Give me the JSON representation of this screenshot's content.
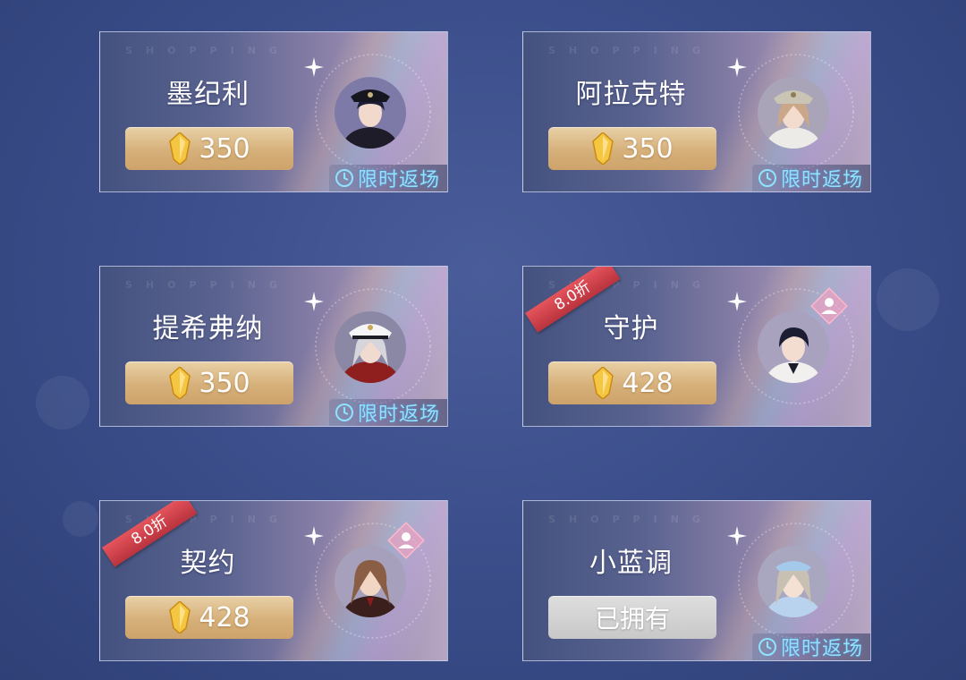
{
  "watermark": "SHOPPING",
  "cards": [
    {
      "name": "墨纪利",
      "price": "350",
      "owned": false,
      "tag": "限时返场",
      "discount": "",
      "has_badge": false
    },
    {
      "name": "阿拉克特",
      "price": "350",
      "owned": false,
      "tag": "限时返场",
      "discount": "",
      "has_badge": false
    },
    {
      "name": "提希弗纳",
      "price": "350",
      "owned": false,
      "tag": "限时返场",
      "discount": "",
      "has_badge": false
    },
    {
      "name": "守护",
      "price": "428",
      "owned": false,
      "tag": "",
      "discount": "8.0折",
      "has_badge": true
    },
    {
      "name": "契约",
      "price": "428",
      "owned": false,
      "tag": "",
      "discount": "8.0折",
      "has_badge": true
    },
    {
      "name": "小蓝调",
      "price": "",
      "owned": true,
      "owned_label": "已拥有",
      "tag": "限时返场",
      "discount": "",
      "has_badge": false
    }
  ],
  "colors": {
    "gold_button": "#d6b07a",
    "owned_button": "#cfcfcf",
    "return_tag_text": "#8fe3ff",
    "discount_ribbon": "#d1434c"
  },
  "icons": {
    "currency": "gem-icon",
    "timer": "clock-icon",
    "character_badge": "person-diamond-icon"
  }
}
